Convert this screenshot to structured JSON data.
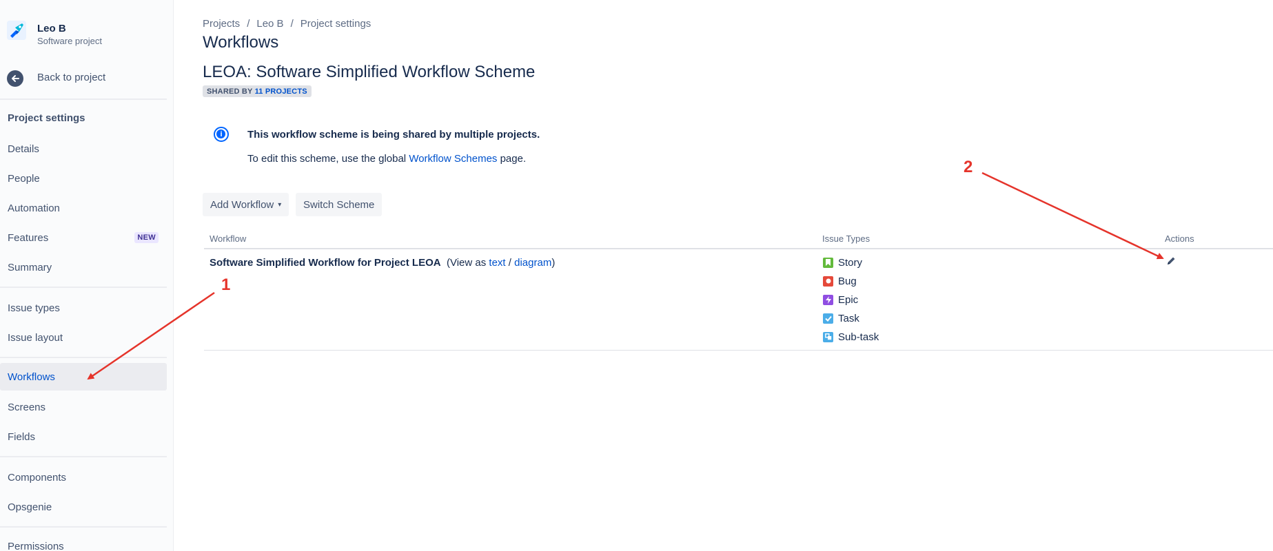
{
  "sidebar": {
    "project_name": "Leo B",
    "project_subtitle": "Software project",
    "back_label": "Back to project",
    "section_heading": "Project settings",
    "items": [
      {
        "label": "Details"
      },
      {
        "label": "People"
      },
      {
        "label": "Automation"
      },
      {
        "label": "Features",
        "badge": "NEW"
      },
      {
        "label": "Summary"
      },
      {
        "label": "Issue types"
      },
      {
        "label": "Issue layout"
      },
      {
        "label": "Workflows",
        "active": true
      },
      {
        "label": "Screens"
      },
      {
        "label": "Fields"
      },
      {
        "label": "Components"
      },
      {
        "label": "Opsgenie"
      },
      {
        "label": "Permissions"
      }
    ]
  },
  "breadcrumb": {
    "items": [
      "Projects",
      "Leo B",
      "Project settings"
    ],
    "separator": "/"
  },
  "page": {
    "title": "Workflows",
    "scheme_title": "LEOA: Software Simplified Workflow Scheme",
    "shared_prefix": "SHARED BY",
    "shared_link": "11 PROJECTS"
  },
  "info": {
    "title": "This workflow scheme is being shared by multiple projects.",
    "body_prefix": "To edit this scheme, use the global",
    "body_link": "Workflow Schemes",
    "body_suffix": "page."
  },
  "toolbar": {
    "add_workflow": "Add Workflow",
    "switch_scheme": "Switch Scheme"
  },
  "table": {
    "headers": {
      "workflow": "Workflow",
      "issue_types": "Issue Types",
      "actions": "Actions"
    },
    "rows": [
      {
        "workflow_name": "Software Simplified Workflow for Project LEOA",
        "view_prefix": "(View as",
        "view_text_link": "text",
        "view_sep": "/",
        "view_diagram_link": "diagram",
        "view_suffix": ")",
        "issue_types": [
          {
            "name": "Story",
            "icon": "story-icon",
            "color": "#63ba3c"
          },
          {
            "name": "Bug",
            "icon": "bug-icon",
            "color": "#e5493a"
          },
          {
            "name": "Epic",
            "icon": "epic-icon",
            "color": "#904ee2"
          },
          {
            "name": "Task",
            "icon": "task-icon",
            "color": "#4bade8"
          },
          {
            "name": "Sub-task",
            "icon": "subtask-icon",
            "color": "#4bade8"
          }
        ]
      }
    ]
  },
  "annotations": {
    "label_1": "1",
    "label_2": "2",
    "color": "#e5342b"
  }
}
